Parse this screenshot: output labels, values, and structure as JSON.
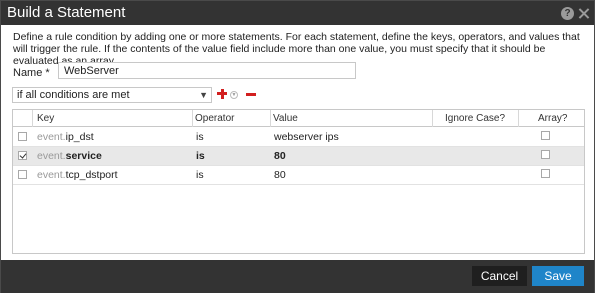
{
  "dialog": {
    "title": "Build a Statement",
    "help_icon_glyph": "?",
    "description": "Define a rule condition by adding one or more statements. For each statement, define the keys, operators, and values that will trigger the rule. If the contents of the value field include more than one value, you must specify that it should be evaluated as an array."
  },
  "form": {
    "name_label": "Name *",
    "name_value": "WebServer",
    "condition_value": "if all conditions are met"
  },
  "table": {
    "columns": [
      "Key",
      "Operator",
      "Value",
      "Ignore Case?",
      "Array?"
    ],
    "rows": [
      {
        "selected": false,
        "key_prefix": "event.",
        "key_name": "ip_dst",
        "operator": "is",
        "value": "webserver ips",
        "ignore_case": false,
        "array": false
      },
      {
        "selected": true,
        "key_prefix": "event.",
        "key_name": "service",
        "operator": "is",
        "value": "80",
        "ignore_case": false,
        "array": false
      },
      {
        "selected": false,
        "key_prefix": "event.",
        "key_name": "tcp_dstport",
        "operator": "is",
        "value": "80",
        "ignore_case": false,
        "array": false
      }
    ]
  },
  "footer": {
    "cancel_label": "Cancel",
    "save_label": "Save"
  },
  "colors": {
    "titlebar": "#333333",
    "save": "#1f85c9",
    "add": "#d21f1f",
    "remove": "#d21f1f"
  },
  "icons": [
    "help-icon",
    "close-icon",
    "chevron-down-icon",
    "add-icon",
    "remove-icon",
    "checkbox-icon"
  ]
}
